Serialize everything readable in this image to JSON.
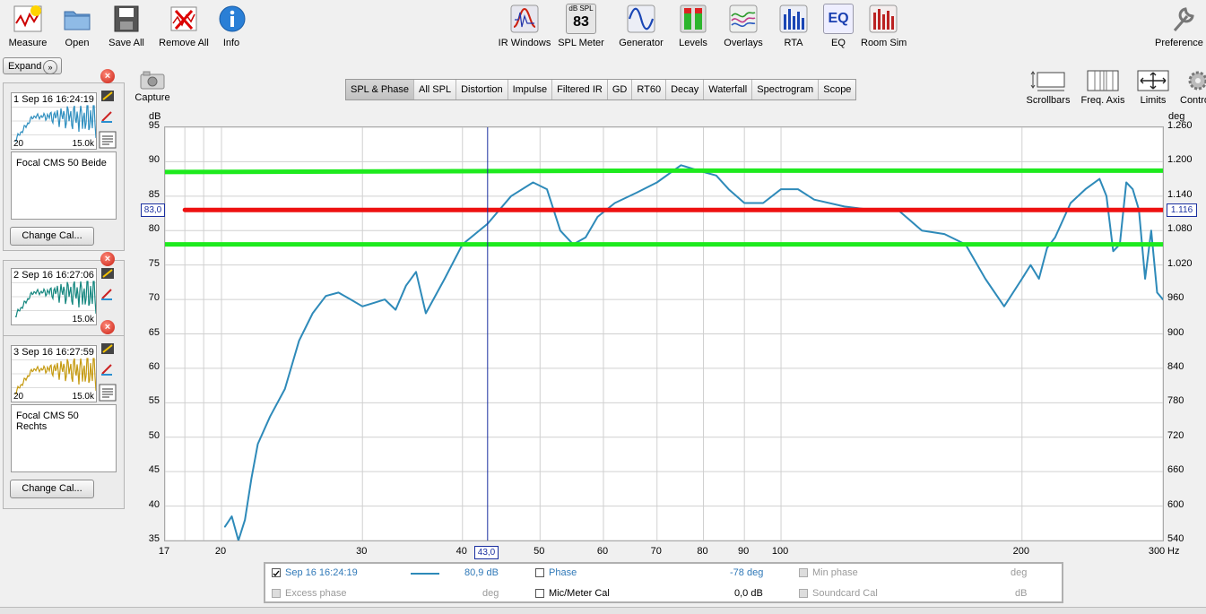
{
  "toolbar_left": [
    {
      "id": "measure",
      "label": "Measure",
      "icon": "measure-icon"
    },
    {
      "id": "open",
      "label": "Open",
      "icon": "folder-icon"
    },
    {
      "id": "save_all",
      "label": "Save All",
      "icon": "save-icon"
    },
    {
      "id": "remove_all",
      "label": "Remove All",
      "icon": "remove-icon"
    },
    {
      "id": "info",
      "label": "Info",
      "icon": "info-icon"
    }
  ],
  "toolbar_center": [
    {
      "id": "ir_windows",
      "label": "IR Windows"
    },
    {
      "id": "spl_meter",
      "label": "SPL Meter",
      "badge_top": "dB SPL",
      "badge_value": "83"
    },
    {
      "id": "generator",
      "label": "Generator"
    },
    {
      "id": "levels",
      "label": "Levels"
    },
    {
      "id": "overlays",
      "label": "Overlays"
    },
    {
      "id": "rta",
      "label": "RTA"
    },
    {
      "id": "eq",
      "label": "EQ",
      "badge_value": "EQ"
    },
    {
      "id": "room_sim",
      "label": "Room Sim"
    }
  ],
  "preferences_label": "Preference",
  "expand_label": "Expand",
  "capture_label": "Capture",
  "tabs": [
    "SPL & Phase",
    "All SPL",
    "Distortion",
    "Impulse",
    "Filtered IR",
    "GD",
    "RT60",
    "Decay",
    "Waterfall",
    "Spectrogram",
    "Scope"
  ],
  "active_tab": "SPL & Phase",
  "view_controls": [
    {
      "id": "scrollbars",
      "label": "Scrollbars"
    },
    {
      "id": "freq_axis",
      "label": "Freq. Axis"
    },
    {
      "id": "limits",
      "label": "Limits"
    },
    {
      "id": "controls",
      "label": "Contro"
    }
  ],
  "measurements": [
    {
      "num": "1",
      "date": "Sep 16 16:24:19",
      "note": "Focal CMS 50 Beide",
      "color": "#2f8fbf",
      "lo": "20",
      "hi": "15.0k",
      "change_cal": "Change Cal..."
    },
    {
      "num": "2",
      "date": "Sep 16 16:27:06",
      "note": "",
      "color": "#15877f",
      "lo": "",
      "hi": "15.0k",
      "change_cal": ""
    },
    {
      "num": "3",
      "date": "Sep 16 16:27:59",
      "note": "Focal CMS 50 Rechts",
      "color": "#c59a10",
      "lo": "20",
      "hi": "15.0k",
      "change_cal": "Change Cal..."
    }
  ],
  "graph": {
    "left_unit": "dB",
    "right_unit": "deg",
    "x_unit": "Hz",
    "cursor_x_label": "43,0",
    "cursor_y_label": "83,0",
    "right_cursor_label": "1.116",
    "y_ticks": [
      "95",
      "90",
      "85",
      "80",
      "75",
      "70",
      "65",
      "60",
      "55",
      "50",
      "45",
      "40",
      "35"
    ],
    "right_ticks": [
      "1.260",
      "1.200",
      "1.140",
      "1.080",
      "1.020",
      "960",
      "900",
      "840",
      "780",
      "720",
      "660",
      "600",
      "540"
    ],
    "x_ticks": [
      {
        "v": 17,
        "label": "17"
      },
      {
        "v": 20,
        "label": "20"
      },
      {
        "v": 30,
        "label": "30"
      },
      {
        "v": 40,
        "label": "40"
      },
      {
        "v": 50,
        "label": "50"
      },
      {
        "v": 60,
        "label": "60"
      },
      {
        "v": 70,
        "label": "70"
      },
      {
        "v": 80,
        "label": "80"
      },
      {
        "v": 90,
        "label": "90"
      },
      {
        "v": 100,
        "label": "100"
      },
      {
        "v": 200,
        "label": "200"
      },
      {
        "v": 300,
        "label": "300"
      }
    ]
  },
  "chart_data": {
    "type": "line",
    "title": "",
    "xlabel": "",
    "ylabel": "dB",
    "xscale": "log",
    "xlim": [
      17,
      300
    ],
    "ylim": [
      35,
      95
    ],
    "y2lim": [
      540,
      1260
    ],
    "grid": true,
    "series": [
      {
        "name": "",
        "color": "#2e8ab9",
        "x": [
          20.2,
          20.6,
          21,
          21.4,
          21.8,
          22.2,
          23,
          24,
          25,
          26,
          27,
          28,
          29,
          30,
          31,
          32,
          33,
          34,
          35,
          36,
          38,
          40,
          43,
          46,
          49,
          51,
          53,
          55,
          57,
          59,
          62,
          66,
          70,
          75,
          80,
          83,
          86,
          90,
          95,
          100,
          105,
          110,
          120,
          130,
          140,
          150,
          160,
          170,
          180,
          190,
          200,
          205,
          210,
          215,
          220,
          230,
          240,
          250,
          255,
          260,
          265,
          270,
          275,
          280,
          285,
          290,
          295,
          300
        ],
        "y": [
          37,
          38.5,
          35,
          38,
          44,
          49,
          53,
          57,
          64,
          68,
          70.5,
          71,
          70,
          69,
          69.5,
          70,
          68.5,
          72,
          74,
          68,
          73,
          78,
          81,
          85,
          87,
          86,
          80,
          78,
          79,
          82,
          84,
          85.5,
          87,
          89.5,
          88.5,
          88,
          86,
          84,
          84,
          86,
          86,
          84.5,
          83.5,
          83,
          83,
          80,
          79.5,
          78,
          73,
          69,
          73,
          75,
          73,
          77.5,
          79,
          84,
          86,
          87.5,
          85,
          77,
          78,
          87,
          86,
          83,
          73,
          80,
          71,
          70
        ]
      },
      {
        "name": "",
        "color": "#1eea1e",
        "x": [
          17,
          71,
          300
        ],
        "y": [
          88.5,
          88.7,
          88.7
        ]
      },
      {
        "name": "",
        "color": "#ee1111",
        "x": [
          18,
          300
        ],
        "y": [
          83,
          83
        ]
      },
      {
        "name": "",
        "color": "#1eea1e",
        "x": [
          17,
          300
        ],
        "y": [
          78,
          78
        ]
      }
    ],
    "cursor": {
      "x": 43.0,
      "y": 83.0
    }
  },
  "legend": {
    "row1": {
      "date": "Sep 16 16:24:19",
      "value": "80,9 dB",
      "phase": "Phase",
      "phase_value": "-78 deg",
      "min_phase": "Min phase",
      "min_phase_unit": "deg"
    },
    "row2": {
      "excess": "Excess phase",
      "excess_unit": "deg",
      "mic": "Mic/Meter Cal",
      "mic_value": "0,0 dB",
      "soundcard": "Soundcard Cal",
      "soundcard_unit": "dB"
    }
  }
}
